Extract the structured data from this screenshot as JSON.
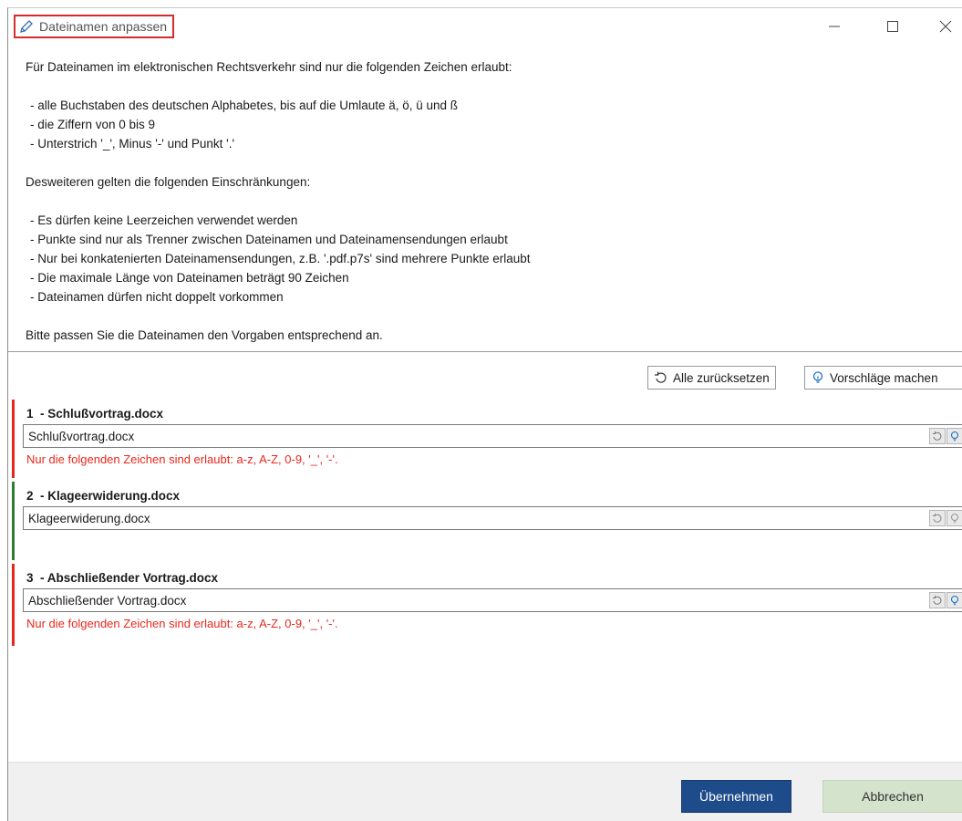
{
  "window": {
    "title": "Dateinamen anpassen",
    "accent_red": "#d62b2b",
    "controls": [
      "minimize-icon",
      "maximize-icon",
      "close-icon"
    ]
  },
  "intro": {
    "line1": "Für Dateinamen im elektronischen Rechtsverkehr sind nur die folgenden Zeichen erlaubt:",
    "allowed": [
      "- alle Buchstaben des deutschen Alphabetes, bis auf die Umlaute ä, ö, ü und ß",
      "- die Ziffern von 0 bis 9",
      "- Unterstrich '_', Minus '-' und Punkt '.'"
    ],
    "line2": "Desweiteren gelten die folgenden Einschränkungen:",
    "restrictions": [
      "- Es dürfen keine Leerzeichen verwendet werden",
      "- Punkte sind nur als Trenner zwischen Dateinamen und Dateinamensendungen erlaubt",
      "- Nur bei konkatenierten Dateinamensendungen, z.B. '.pdf.p7s' sind mehrere Punkte erlaubt",
      "- Die maximale Länge von Dateinamen beträgt 90 Zeichen",
      "- Dateinamen dürfen nicht doppelt vorkommen"
    ],
    "line3": "Bitte passen Sie die Dateinamen den Vorgaben entsprechend an."
  },
  "toolbar": {
    "reset_all_label": "Alle zurücksetzen",
    "reset_all_icon": "undo-icon",
    "suggest_label": "Vorschläge machen",
    "suggest_icon": "lightbulb-icon"
  },
  "files": [
    {
      "header": "1  - Schlußvortrag.docx",
      "value": "Schlußvortrag.docx",
      "status": "error",
      "status_color": "#e8271c",
      "error": "Nur die folgenden Zeichen sind erlaubt: a-z, A-Z, 0-9, '_', '-'."
    },
    {
      "header": "2  - Klageerwiderung.docx",
      "value": "Klageerwiderung.docx",
      "status": "ok",
      "status_color": "#2e7d32",
      "error": ""
    },
    {
      "header": "3  - Abschließender Vortrag.docx",
      "value": "Abschließender Vortrag.docx",
      "status": "error",
      "status_color": "#e8271c",
      "error": "Nur die folgenden Zeichen sind erlaubt: a-z, A-Z, 0-9, '_', '-'."
    }
  ],
  "footer": {
    "ok_label": "Übernehmen",
    "ok_color": "#1e4b8a",
    "cancel_label": "Abbrechen",
    "cancel_color": "#d4e3cc"
  }
}
